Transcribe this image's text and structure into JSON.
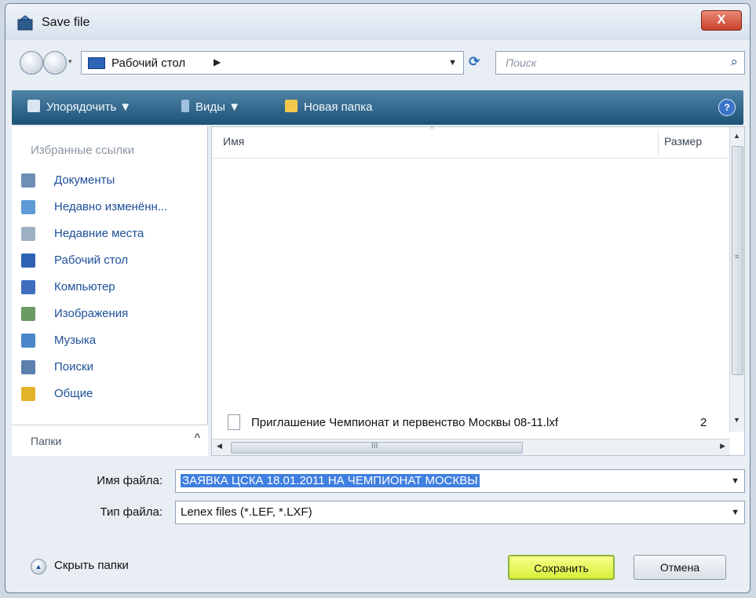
{
  "window": {
    "title": "Save file",
    "close_label": "X"
  },
  "address": {
    "path_label": "Рабочий стол",
    "path_arrow": "▶",
    "dropdown": "▼",
    "refresh": "⟳",
    "search_placeholder": "Поиск",
    "search_icon": "⌕"
  },
  "toolbar": {
    "organize": "Упорядочить ▼",
    "views": "Виды ▼",
    "new_folder": "Новая папка",
    "help": "?"
  },
  "sidebar": {
    "header": "Избранные ссылки",
    "items": [
      {
        "label": "Документы",
        "icon": "documents-icon",
        "color": "#6d8fb5"
      },
      {
        "label": "Недавно изменённ...",
        "icon": "recent-icon",
        "color": "#5f9bd6"
      },
      {
        "label": "Недавние места",
        "icon": "places-icon",
        "color": "#9fb0c2"
      },
      {
        "label": "Рабочий стол",
        "icon": "desktop-icon",
        "color": "#2f62b3"
      },
      {
        "label": "Компьютер",
        "icon": "computer-icon",
        "color": "#3f6dbf"
      },
      {
        "label": "Изображения",
        "icon": "pictures-icon",
        "color": "#6c9a63"
      },
      {
        "label": "Музыка",
        "icon": "music-icon",
        "color": "#4a86c9"
      },
      {
        "label": "Поиски",
        "icon": "searches-icon",
        "color": "#5c7fae"
      },
      {
        "label": "Общие",
        "icon": "public-icon",
        "color": "#e3b32a"
      }
    ],
    "folders_label": "Папки",
    "folders_chevron": "^"
  },
  "filelist": {
    "columns": {
      "name": "Имя",
      "size": "Размер"
    },
    "files": [
      {
        "name": "Приглашение Чемпионат и первенство Москвы 08-11.lxf",
        "size": "2"
      }
    ],
    "v_grip": "≡",
    "h_grip": "III"
  },
  "form": {
    "filename_label": "Имя файла:",
    "filename_value": "ЗАЯВКА ЦСКА 18.01.2011 НА ЧЕМПИОНАТ МОСКВЫ",
    "filetype_label": "Тип файла:",
    "filetype_value": "Lenex files (*.LEF, *.LXF)"
  },
  "footer": {
    "hide_folders": "Скрыть папки",
    "save": "Сохранить",
    "cancel": "Отмена"
  }
}
